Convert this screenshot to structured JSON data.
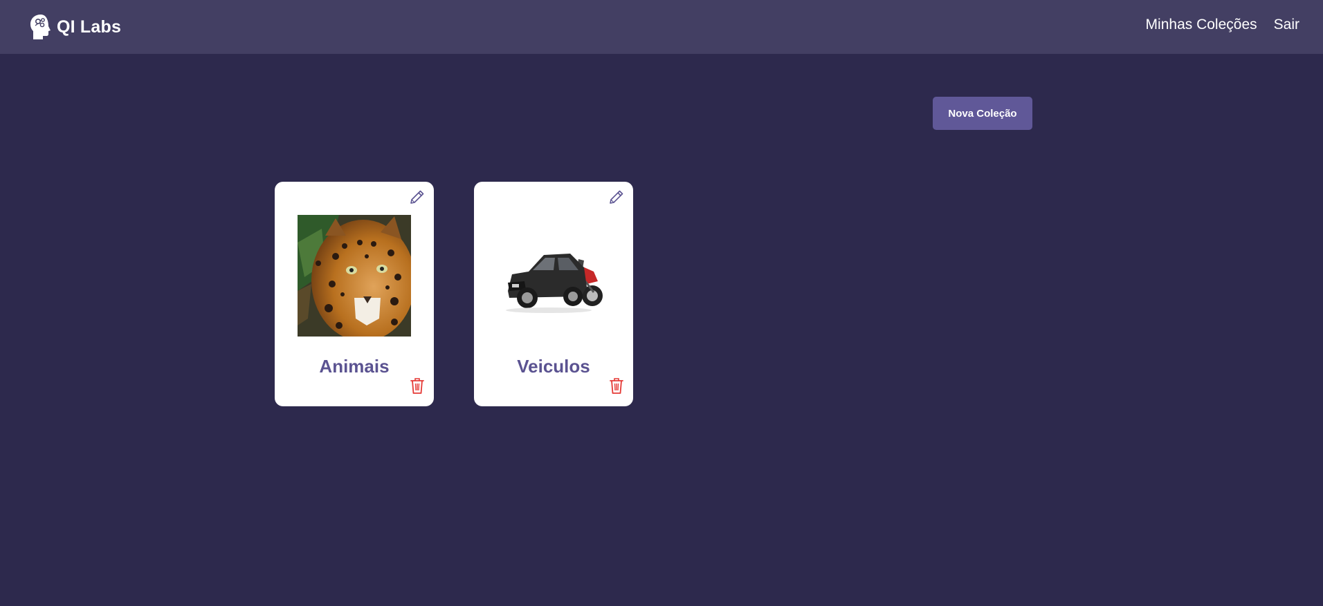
{
  "header": {
    "brand_name": "QI Labs",
    "brand_icon": "head-brain-icon",
    "nav": [
      {
        "label": "Minhas Coleções"
      },
      {
        "label": "Sair"
      }
    ]
  },
  "actions": {
    "new_collection_label": "Nova Coleção"
  },
  "collections": [
    {
      "title": "Animais",
      "image": "jaguar-photo",
      "edit_icon": "pencil-icon",
      "delete_icon": "trash-icon"
    },
    {
      "title": "Veiculos",
      "image": "car-and-motorcycle-photo",
      "edit_icon": "pencil-icon",
      "delete_icon": "trash-icon"
    }
  ],
  "colors": {
    "background": "#2d294d",
    "navbar": "#433f63",
    "button": "#605898",
    "card_title": "#5b5391",
    "edit_icon": "#5b5391",
    "delete_icon": "#e53935"
  }
}
